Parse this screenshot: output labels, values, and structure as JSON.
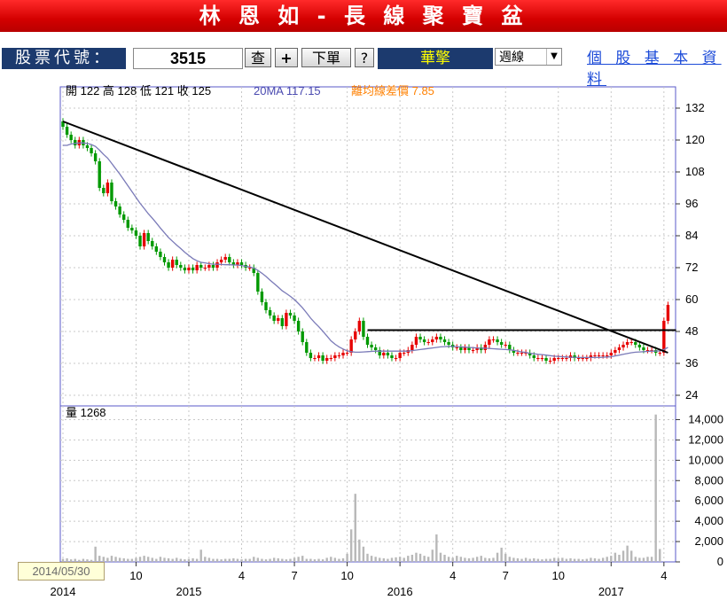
{
  "header": {
    "title": "林 恩 如 - 長 線 聚 寶 盆"
  },
  "toolbar": {
    "code_label": "股票代號：",
    "code_value": "3515",
    "query_label": "查",
    "add_label": "+",
    "order_label": "下單",
    "help_label": "?",
    "stock_name": "華擎",
    "period_value": "週線",
    "profile_link": "個 股 基 本 資 料"
  },
  "info": {
    "ohlc": "開 122  高 128  低 121  收 125",
    "ma": "20MA 117.15",
    "bias": "離均線差價 7.85"
  },
  "volume_info": "量 1268",
  "date_tag": "2014/05/30",
  "colors": {
    "up": "#e60000",
    "down": "#009900",
    "ma": "#7a7ab8",
    "trend": "#000000"
  },
  "chart_data": {
    "type": "candlestick",
    "price_axis": {
      "ticks": [
        132,
        120,
        108,
        96,
        84,
        72,
        60,
        48,
        36,
        24
      ],
      "range": [
        20,
        140
      ]
    },
    "volume_axis": {
      "ticks": [
        14000,
        12000,
        10000,
        8000,
        6000,
        4000,
        2000,
        0
      ],
      "range": [
        0,
        15000
      ]
    },
    "x_ticks": [
      {
        "label": "2014",
        "week": 0
      },
      {
        "label": "10",
        "week": 18
      },
      {
        "label": "2015",
        "week": 31
      },
      {
        "label": "4",
        "week": 44
      },
      {
        "label": "7",
        "week": 57
      },
      {
        "label": "10",
        "week": 70
      },
      {
        "label": "2016",
        "week": 83
      },
      {
        "label": "4",
        "week": 96
      },
      {
        "label": "7",
        "week": 109
      },
      {
        "label": "10",
        "week": 122
      },
      {
        "label": "2017",
        "week": 135
      },
      {
        "label": "4",
        "week": 148
      }
    ],
    "closes": [
      125,
      122,
      120,
      118,
      120,
      118,
      117,
      115,
      112,
      102,
      100,
      104,
      97,
      95,
      92,
      90,
      87,
      86,
      84,
      80,
      85,
      82,
      80,
      78,
      76,
      74,
      72,
      75,
      73,
      72,
      71,
      72,
      71,
      73,
      72,
      72,
      73,
      72,
      74,
      75,
      76,
      74,
      73,
      74,
      73,
      72,
      72,
      70,
      63,
      59,
      56,
      54,
      52,
      53,
      50,
      55,
      54,
      52,
      48,
      44,
      40,
      38,
      38,
      39,
      37,
      38,
      38,
      39,
      39,
      40,
      40,
      45,
      48,
      52,
      46,
      43,
      42,
      41,
      39,
      40,
      39,
      38,
      38,
      40,
      40,
      41,
      43,
      46,
      45,
      44,
      44,
      45,
      46,
      45,
      44,
      43,
      42,
      42,
      41,
      42,
      41,
      41,
      42,
      41,
      43,
      45,
      45,
      44,
      43,
      43,
      41,
      40,
      40,
      40,
      40,
      39,
      38,
      38,
      38,
      37,
      37,
      38,
      38,
      38,
      38,
      39,
      38,
      38,
      38,
      38,
      39,
      39,
      39,
      39,
      39,
      40,
      41,
      42,
      43,
      44,
      44,
      43,
      42,
      41,
      41,
      41,
      40,
      40,
      52,
      58
    ],
    "ma20": [
      118,
      118,
      118.5,
      118.7,
      118.9,
      118.9,
      118.7,
      118.3,
      117.6,
      116.2,
      114.6,
      113.2,
      111.2,
      109.2,
      107.2,
      105,
      102.8,
      100.6,
      98.4,
      96.2,
      94.3,
      92.3,
      90.6,
      88.8,
      86.9,
      85.1,
      83.3,
      81.9,
      80.5,
      79.2,
      77.8,
      76.6,
      75.4,
      74.6,
      74,
      73.8,
      73.5,
      73.3,
      73.3,
      73.2,
      73.1,
      73.1,
      73,
      73,
      72.8,
      72.5,
      72.3,
      71.8,
      71,
      69.9,
      68.7,
      67.3,
      66,
      64.7,
      63.3,
      62.3,
      61.2,
      60,
      58.5,
      56.9,
      55,
      53,
      51.3,
      49.8,
      48.1,
      46.3,
      44.5,
      43.2,
      42.2,
      41.4,
      40.7,
      40.4,
      40.2,
      40.2,
      40.3,
      40.4,
      40.5,
      40.6,
      40.6,
      40.6,
      40.6,
      40.6,
      40.6,
      40.6,
      40.6,
      40.6,
      40.8,
      41,
      41.2,
      41.4,
      41.6,
      41.8,
      42,
      42.2,
      42.3,
      42.4,
      42.4,
      42.3,
      42.2,
      42.1,
      42,
      41.9,
      41.8,
      41.7,
      41.7,
      41.6,
      41.5,
      41.4,
      41.3,
      41.2,
      41.1,
      40.9,
      40.6,
      40.3,
      40.1,
      39.8,
      39.6,
      39.4,
      39.3,
      39.1,
      38.9,
      38.7,
      38.6,
      38.5,
      38.4,
      38.3,
      38.3,
      38.2,
      38.2,
      38.2,
      38.2,
      38.2,
      38.2,
      38.3,
      38.4,
      38.5,
      38.8,
      39.1,
      39.4,
      39.7,
      40,
      40.2,
      40.3,
      40.4,
      40.5,
      40.6,
      40.6,
      40.7,
      41.2,
      42
    ],
    "volumes": [
      300,
      350,
      250,
      300,
      200,
      300,
      250,
      200,
      1500,
      600,
      500,
      400,
      600,
      500,
      400,
      350,
      300,
      300,
      400,
      500,
      600,
      500,
      400,
      300,
      500,
      400,
      350,
      300,
      400,
      300,
      250,
      300,
      350,
      300,
      1200,
      500,
      400,
      300,
      300,
      250,
      300,
      300,
      350,
      300,
      250,
      300,
      300,
      500,
      400,
      300,
      250,
      300,
      400,
      350,
      300,
      250,
      300,
      400,
      500,
      600,
      300,
      300,
      250,
      300,
      250,
      400,
      500,
      400,
      300,
      350,
      800,
      3200,
      6700,
      2200,
      1500,
      800,
      600,
      500,
      400,
      350,
      300,
      400,
      450,
      500,
      400,
      600,
      700,
      900,
      800,
      600,
      500,
      1200,
      2700,
      900,
      700,
      500,
      400,
      600,
      500,
      400,
      350,
      400,
      500,
      600,
      400,
      350,
      400,
      900,
      1400,
      800,
      500,
      400,
      350,
      300,
      400,
      300,
      350,
      300,
      250,
      300,
      300,
      400,
      350,
      400,
      300,
      350,
      300,
      300,
      250,
      300,
      400,
      350,
      300,
      400,
      500,
      600,
      900,
      700,
      1100,
      1600,
      1100,
      500,
      400,
      400,
      500,
      500,
      14500,
      1268
    ],
    "trendlines": [
      {
        "from": [
          0,
          127
        ],
        "to": [
          149,
          40
        ]
      },
      {
        "from": [
          75,
          48.5
        ],
        "to": [
          151,
          48.5
        ]
      }
    ]
  }
}
